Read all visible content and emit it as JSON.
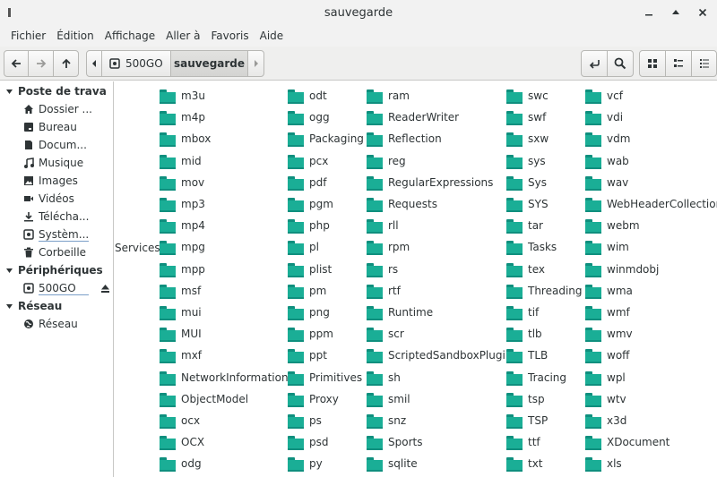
{
  "window": {
    "title": "sauvegarde"
  },
  "menu": [
    "Fichier",
    "Édition",
    "Affichage",
    "Aller à",
    "Favoris",
    "Aide"
  ],
  "path": {
    "drive": "500GO",
    "current": "sauvegarde"
  },
  "sidebar": {
    "places_title": "Poste de trava",
    "places": [
      {
        "label": "Dossier ...",
        "icon": "home-icon"
      },
      {
        "label": "Bureau",
        "icon": "desktop-icon"
      },
      {
        "label": "Docum...",
        "icon": "documents-icon"
      },
      {
        "label": "Musique",
        "icon": "music-icon"
      },
      {
        "label": "Images",
        "icon": "images-icon"
      },
      {
        "label": "Vidéos",
        "icon": "video-icon"
      },
      {
        "label": "Télécha...",
        "icon": "download-icon"
      },
      {
        "label": "Systèm...",
        "icon": "drive-icon"
      },
      {
        "label": "Corbeille",
        "icon": "trash-icon"
      }
    ],
    "devices_title": "Périphériques",
    "devices": [
      {
        "label": "500GO",
        "icon": "drive-icon"
      }
    ],
    "network_title": "Réseau",
    "network": [
      {
        "label": "Réseau",
        "icon": "network-icon"
      }
    ]
  },
  "files": {
    "partial_label": "Services",
    "col1": [
      "m3u",
      "m4p",
      "mbox",
      "mid",
      "mov",
      "mp3",
      "mp4",
      "mpg",
      "mpp",
      "msf",
      "mui",
      "MUI",
      "mxf",
      "NetworkInformation",
      "ObjectModel",
      "ocx",
      "OCX",
      "odg"
    ],
    "col2": [
      "odt",
      "ogg",
      "Packaging",
      "pcx",
      "pdf",
      "pgm",
      "php",
      "pl",
      "plist",
      "pm",
      "png",
      "ppm",
      "ppt",
      "Primitives",
      "Proxy",
      "ps",
      "psd",
      "py"
    ],
    "col3": [
      "ram",
      "ReaderWriter",
      "Reflection",
      "reg",
      "RegularExpressions",
      "Requests",
      "rll",
      "rpm",
      "rs",
      "rtf",
      "Runtime",
      "scr",
      "ScriptedSandboxPlugin",
      "sh",
      "smil",
      "snz",
      "Sports",
      "sqlite"
    ],
    "col4": [
      "swc",
      "swf",
      "sxw",
      "sys",
      "Sys",
      "SYS",
      "tar",
      "Tasks",
      "tex",
      "Threading",
      "tif",
      "tlb",
      "TLB",
      "Tracing",
      "tsp",
      "TSP",
      "ttf",
      "txt"
    ],
    "col5": [
      "vcf",
      "vdi",
      "vdm",
      "wab",
      "wav",
      "WebHeaderCollection",
      "webm",
      "wim",
      "winmdobj",
      "wma",
      "wmf",
      "wmv",
      "woff",
      "wpl",
      "wtv",
      "x3d",
      "XDocument",
      "xls"
    ]
  }
}
